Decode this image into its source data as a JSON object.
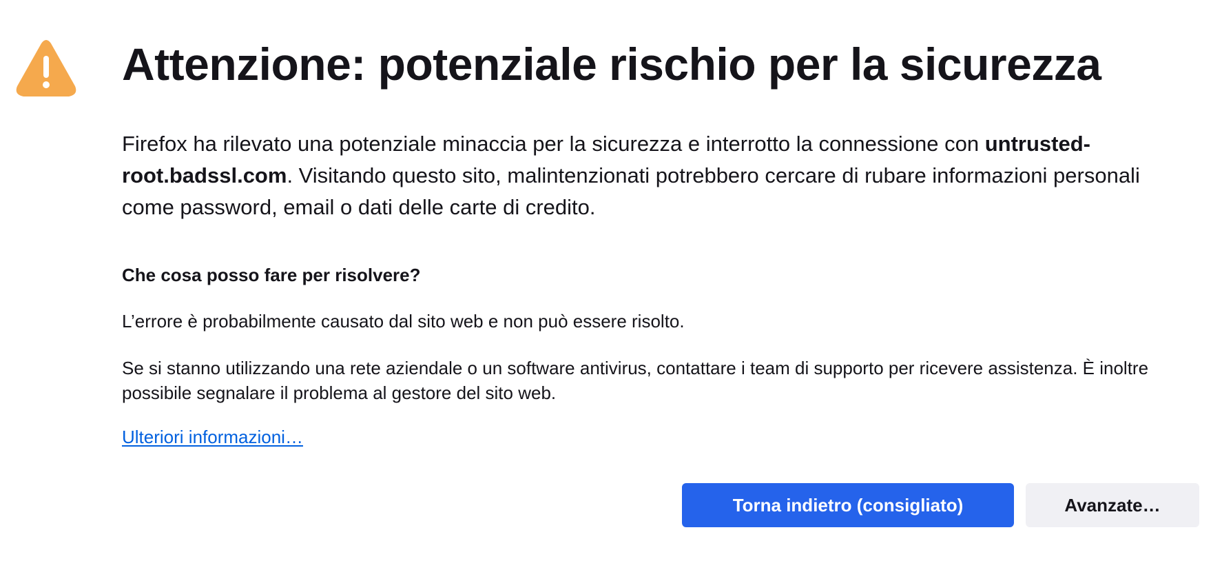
{
  "icon": {
    "name": "warning-icon",
    "color": "#f5a94d"
  },
  "title": "Attenzione: potenziale rischio per la sicurezza",
  "intro": {
    "text_before": "Firefox ha rilevato una potenziale minaccia per la sicurezza e interrotto la connessione con ",
    "hostname": "untrusted-root.badssl.com",
    "text_after": ". Visitando questo sito, malintenzionati potrebbero cercare di rubare informazioni personali come password, email o dati delle carte di credito."
  },
  "help": {
    "heading": "Che cosa posso fare per risolvere?",
    "paragraph1": "L’errore è probabilmente causato dal sito web e non può essere risolto.",
    "paragraph2": "Se si stanno utilizzando una rete aziendale o un software antivirus, contattare i team di supporto per ricevere assistenza. È inoltre possibile segnalare il problema al gestore del sito web.",
    "learn_more": "Ulteriori informazioni…"
  },
  "buttons": {
    "back": "Torna indietro (consigliato)",
    "advanced": "Avanzate…"
  },
  "colors": {
    "accent": "#2563eb",
    "link": "#0060df",
    "warning": "#f5a94d",
    "secondary_button": "#f0f0f4",
    "text": "#15141a"
  }
}
